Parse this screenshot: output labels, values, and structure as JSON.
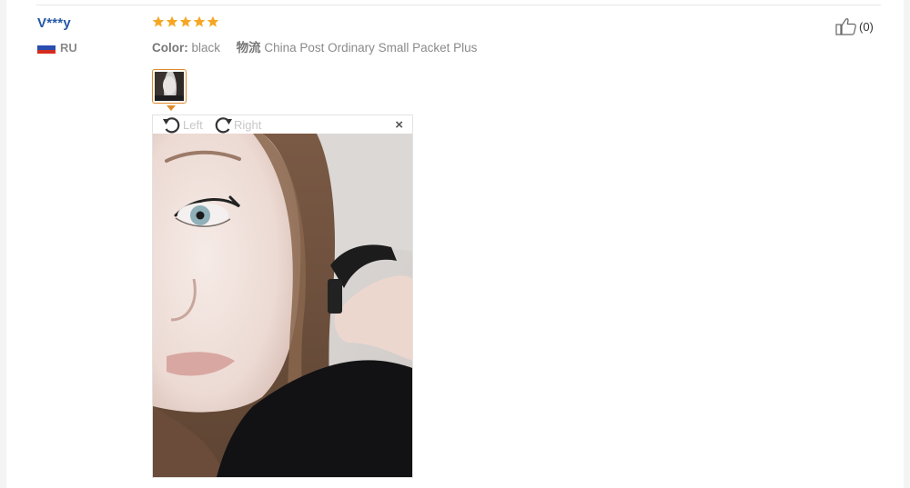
{
  "review": {
    "user_name": "V***y",
    "country_code": "RU",
    "rating_stars": 5,
    "color_label": "Color:",
    "color_value": "black",
    "shipping_label": "物流",
    "shipping_value": "China Post Ordinary Small Packet Plus",
    "helpful_count": "(0)"
  },
  "viewer": {
    "rotate_left_label": "Left",
    "rotate_right_label": "Right",
    "close_symbol": "×"
  },
  "colors": {
    "username": "#2458a6",
    "star": "#f5a623",
    "accent_border": "#e08a2b",
    "muted_text": "#8a8a8a"
  },
  "icons": {
    "flag": "russia-flag-icon",
    "rating": "star-icon",
    "helpful": "thumbs-up-icon",
    "rotate_left": "rotate-left-icon",
    "rotate_right": "rotate-right-icon",
    "close": "close-icon"
  }
}
